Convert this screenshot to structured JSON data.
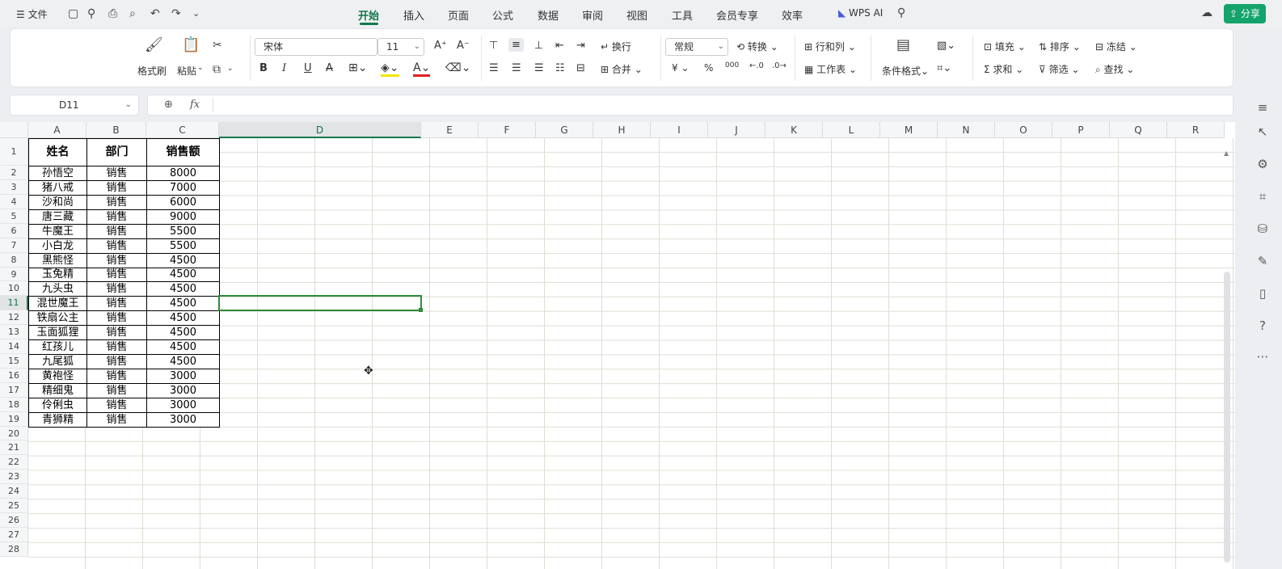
{
  "menubar": {
    "file": "文件",
    "tabs": [
      "开始",
      "插入",
      "页面",
      "公式",
      "数据",
      "审阅",
      "视图",
      "工具",
      "会员专享",
      "效率"
    ],
    "wps_ai": "WPS AI",
    "share": "分享"
  },
  "ribbon": {
    "format_painter": "格式刷",
    "paste": "粘贴",
    "font_name": "宋体",
    "font_size": "11",
    "wrap": "换行",
    "merge": "合并",
    "number_format": "常规",
    "convert": "转换",
    "row_col": "行和列",
    "worksheet": "工作表",
    "cond_format": "条件格式",
    "fill": "填充",
    "sort": "排序",
    "freeze": "冻结",
    "sum": "求和",
    "filter": "筛选",
    "find": "查找",
    "bold": "B",
    "italic": "I",
    "underline": "U",
    "strike": "A",
    "percent": "%",
    "yen": "¥",
    "thousands": "000"
  },
  "formula_bar": {
    "name_box": "D11",
    "fx": "fx",
    "formula": ""
  },
  "columns": [
    "A",
    "B",
    "C",
    "D",
    "E",
    "F",
    "G",
    "H",
    "I",
    "J",
    "K",
    "L",
    "M",
    "N",
    "O",
    "P",
    "Q",
    "R"
  ],
  "rows": [
    "1",
    "2",
    "3",
    "4",
    "5",
    "6",
    "7",
    "8",
    "9",
    "10",
    "11",
    "12",
    "13",
    "14",
    "15",
    "16",
    "17",
    "18",
    "19",
    "20",
    "21",
    "22",
    "23",
    "24",
    "25",
    "26",
    "27",
    "28"
  ],
  "table": {
    "headers": [
      "姓名",
      "部门",
      "销售额"
    ],
    "rows": [
      [
        "孙悟空",
        "销售",
        "8000"
      ],
      [
        "猪八戒",
        "销售",
        "7000"
      ],
      [
        "沙和尚",
        "销售",
        "6000"
      ],
      [
        "唐三藏",
        "销售",
        "9000"
      ],
      [
        "牛魔王",
        "销售",
        "5500"
      ],
      [
        "小白龙",
        "销售",
        "5500"
      ],
      [
        "黑熊怪",
        "销售",
        "4500"
      ],
      [
        "玉兔精",
        "销售",
        "4500"
      ],
      [
        "九头虫",
        "销售",
        "4500"
      ],
      [
        "混世魔王",
        "销售",
        "4500"
      ],
      [
        "铁扇公主",
        "销售",
        "4500"
      ],
      [
        "玉面狐狸",
        "销售",
        "4500"
      ],
      [
        "红孩儿",
        "销售",
        "4500"
      ],
      [
        "九尾狐",
        "销售",
        "4500"
      ],
      [
        "黄袍怪",
        "销售",
        "3000"
      ],
      [
        "精细鬼",
        "销售",
        "3000"
      ],
      [
        "伶俐虫",
        "销售",
        "3000"
      ],
      [
        "青狮精",
        "销售",
        "3000"
      ]
    ]
  },
  "selection": {
    "cell": "D11",
    "color": "#2e8b3a"
  },
  "accent": "#13784a"
}
